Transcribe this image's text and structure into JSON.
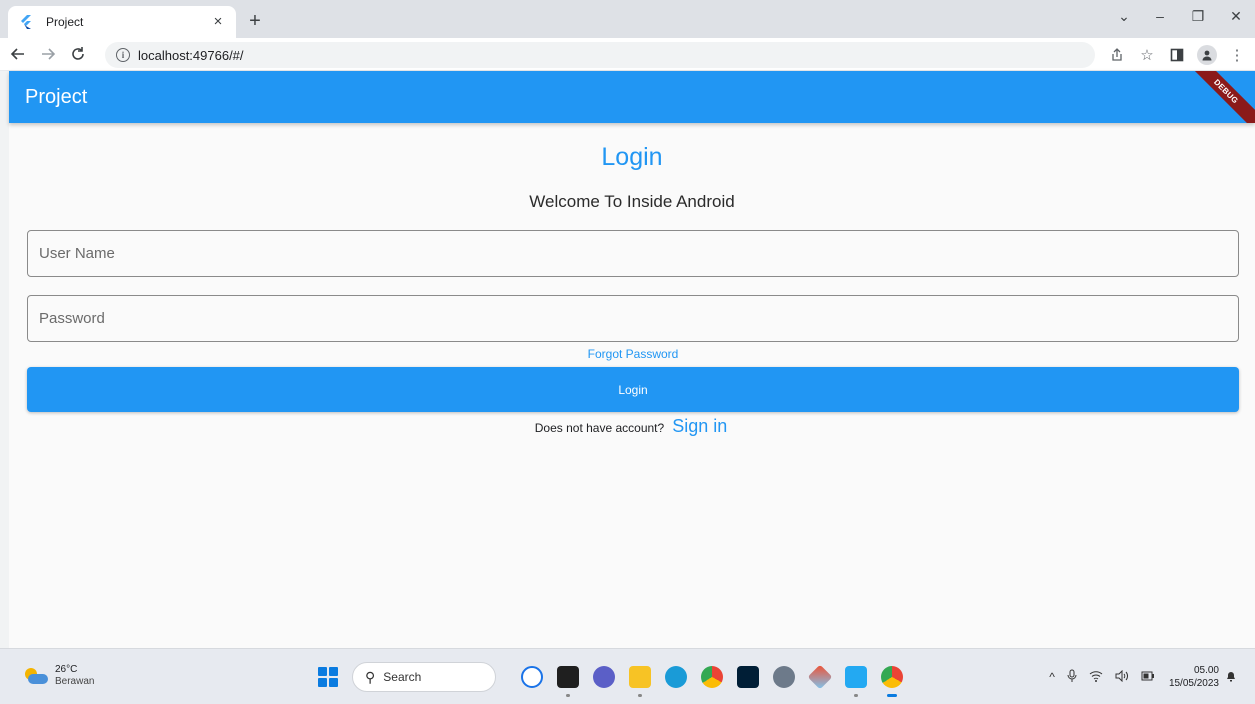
{
  "browser": {
    "tab_title": "Project",
    "tab_close": "×",
    "new_tab": "+",
    "url": "localhost:49766/#/",
    "window_controls": {
      "tab_search": "⌄",
      "minimize": "–",
      "restore": "❐",
      "close": "✕"
    }
  },
  "app": {
    "appbar_title": "Project",
    "debug_banner": "DEBUG",
    "login_title": "Login",
    "welcome": "Welcome To Inside Android",
    "username_placeholder": "User Name",
    "password_placeholder": "Password",
    "forgot_password": "Forgot Password",
    "login_button": "Login",
    "no_account_text": "Does not have account?",
    "sign_in_link": "Sign in",
    "colors": {
      "primary": "#2196f3",
      "debug": "#8b1a1a"
    }
  },
  "taskbar": {
    "weather_temp": "26°C",
    "weather_desc": "Berawan",
    "search_label": "Search",
    "time": "05.00",
    "date": "15/05/2023",
    "apps": [
      "bing-icon",
      "file-manager-icon",
      "chat-icon",
      "file-explorer-icon",
      "edge-icon",
      "chrome-icon",
      "photoshop-icon",
      "settings-icon",
      "git-icon",
      "vscode-icon",
      "chrome-active-icon"
    ]
  }
}
